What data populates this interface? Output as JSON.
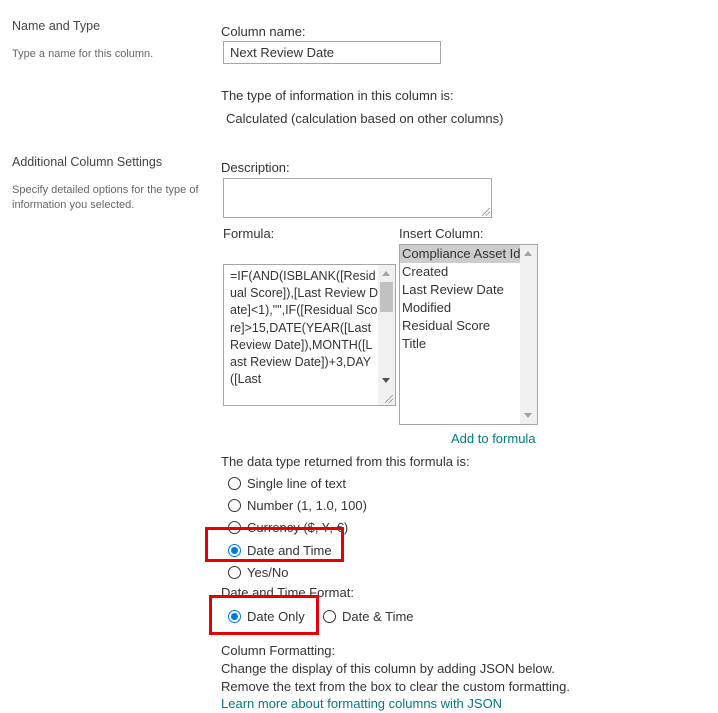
{
  "name_and_type": {
    "title": "Name and Type",
    "description": "Type a name for this column."
  },
  "column_name": {
    "label": "Column name:",
    "value": "Next Review Date"
  },
  "type_info": {
    "label": "The type of information in this column is:",
    "value": "Calculated (calculation based on other columns)"
  },
  "additional_settings": {
    "title": "Additional Column Settings",
    "description": "Specify detailed options for the type of information you selected."
  },
  "description_field": {
    "label": "Description:",
    "value": ""
  },
  "formula": {
    "label": "Formula:",
    "value": "=IF(AND(ISBLANK([Residual Score]),[Last Review Date]<1),\"\",IF([Residual Score]>15,DATE(YEAR([Last Review Date]),MONTH([Last Review Date])+3,DAY([Last"
  },
  "insert_column": {
    "label": "Insert Column:",
    "items": [
      {
        "label": "Compliance Asset Id",
        "selected": true
      },
      {
        "label": "Created",
        "selected": false
      },
      {
        "label": "Last Review Date",
        "selected": false
      },
      {
        "label": "Modified",
        "selected": false
      },
      {
        "label": "Residual Score",
        "selected": false
      },
      {
        "label": "Title",
        "selected": false
      }
    ],
    "add_link": "Add to formula"
  },
  "return_type": {
    "label": "The data type returned from this formula is:",
    "options": [
      {
        "label": "Single line of text",
        "checked": false
      },
      {
        "label": "Number (1, 1.0, 100)",
        "checked": false
      },
      {
        "label": "Currency ($, ¥, €)",
        "checked": false
      },
      {
        "label": "Date and Time",
        "checked": true
      },
      {
        "label": "Yes/No",
        "checked": false
      }
    ]
  },
  "date_format": {
    "label": "Date and Time Format:",
    "options": [
      {
        "label": "Date Only",
        "checked": true
      },
      {
        "label": "Date & Time",
        "checked": false
      }
    ]
  },
  "column_formatting": {
    "label": "Column Formatting:",
    "line1": "Change the display of this column by adding JSON below.",
    "line2": "Remove the text from the box to clear the custom formatting.",
    "link": "Learn more about formatting columns with JSON"
  },
  "colors": {
    "accent_link": "#03787c",
    "radio_checked": "#0078d4",
    "highlight_box": "#e60000"
  }
}
